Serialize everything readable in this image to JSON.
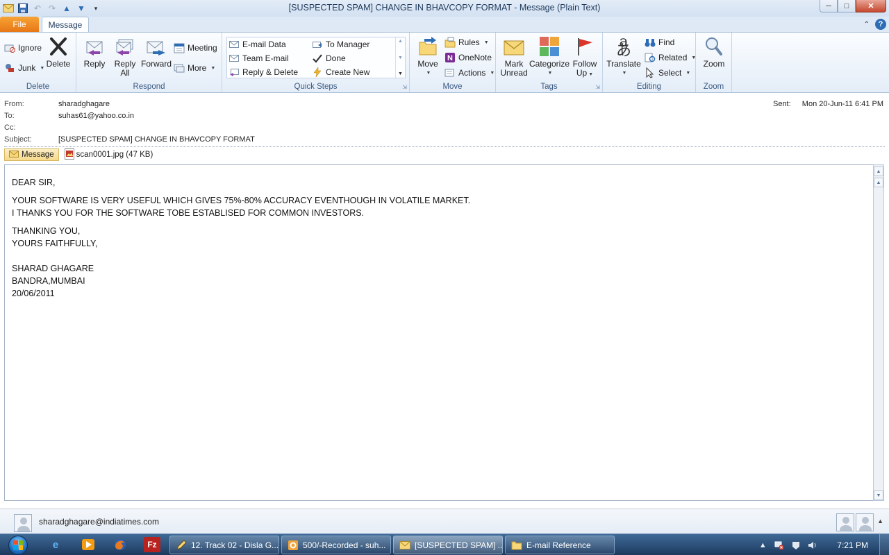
{
  "window": {
    "title": "[SUSPECTED SPAM] CHANGE IN BHAVCOPY FORMAT  -  Message (Plain Text)",
    "minimize": "─",
    "maximize": "□",
    "close": "✕"
  },
  "tabs": {
    "file": "File",
    "message": "Message"
  },
  "ribbon": {
    "delete_group": {
      "label": "Delete",
      "ignore": "Ignore",
      "junk": "Junk",
      "delete": "Delete"
    },
    "respond_group": {
      "label": "Respond",
      "reply": "Reply",
      "reply_all_line1": "Reply",
      "reply_all_line2": "All",
      "forward": "Forward",
      "meeting": "Meeting",
      "more": "More"
    },
    "quick_steps": {
      "label": "Quick Steps",
      "items": [
        "E-mail Data",
        "To Manager",
        "Team E-mail",
        "Done",
        "Reply & Delete",
        "Create New"
      ]
    },
    "move_group": {
      "label": "Move",
      "move": "Move",
      "rules": "Rules",
      "onenote": "OneNote",
      "actions": "Actions"
    },
    "tags_group": {
      "label": "Tags",
      "mark_unread_line1": "Mark",
      "mark_unread_line2": "Unread",
      "categorize": "Categorize",
      "follow_up_line1": "Follow",
      "follow_up_line2": "Up"
    },
    "editing_group": {
      "label": "Editing",
      "translate": "Translate",
      "find": "Find",
      "related": "Related",
      "select": "Select"
    },
    "zoom_group": {
      "label": "Zoom",
      "zoom": "Zoom"
    }
  },
  "header": {
    "from_label": "From:",
    "from_value": "sharadghagare",
    "to_label": "To:",
    "to_value": "suhas61@yahoo.co.in",
    "cc_label": "Cc:",
    "cc_value": "",
    "subject_label": "Subject:",
    "subject_value": "[SUSPECTED SPAM] CHANGE IN BHAVCOPY FORMAT",
    "sent_label": "Sent:",
    "sent_value": "Mon 20-Jun-11 6:41 PM"
  },
  "attachments": {
    "message_tab": "Message",
    "file": "scan0001.jpg (47 KB)"
  },
  "body": {
    "greeting": "DEAR SIR,",
    "line1": "YOUR SOFTWARE IS VERY USEFUL WHICH GIVES 75%-80% ACCURACY EVENTHOUGH IN VOLATILE MARKET.",
    "line2": "I THANKS YOU FOR THE SOFTWARE TOBE ESTABLISED FOR COMMON INVESTORS.",
    "closing1": "THANKING YOU,",
    "closing2": "YOURS FAITHFULLY,",
    "sig_name": "SHARAD GHAGARE",
    "sig_place": "BANDRA,MUMBAI",
    "sig_date": "20/06/2011"
  },
  "people_pane": {
    "contact": "sharadghagare@indiatimes.com"
  },
  "taskbar": {
    "buttons": [
      "12. Track 02 - Disla G...",
      "500/-Recorded - suh...",
      "[SUSPECTED SPAM] ...",
      "E-mail Reference"
    ],
    "clock": "7:21 PM"
  },
  "colors": {
    "file_tab": "#e77817",
    "ribbon_bg": "#e4edf8",
    "taskbar": "#1c3a5e"
  }
}
